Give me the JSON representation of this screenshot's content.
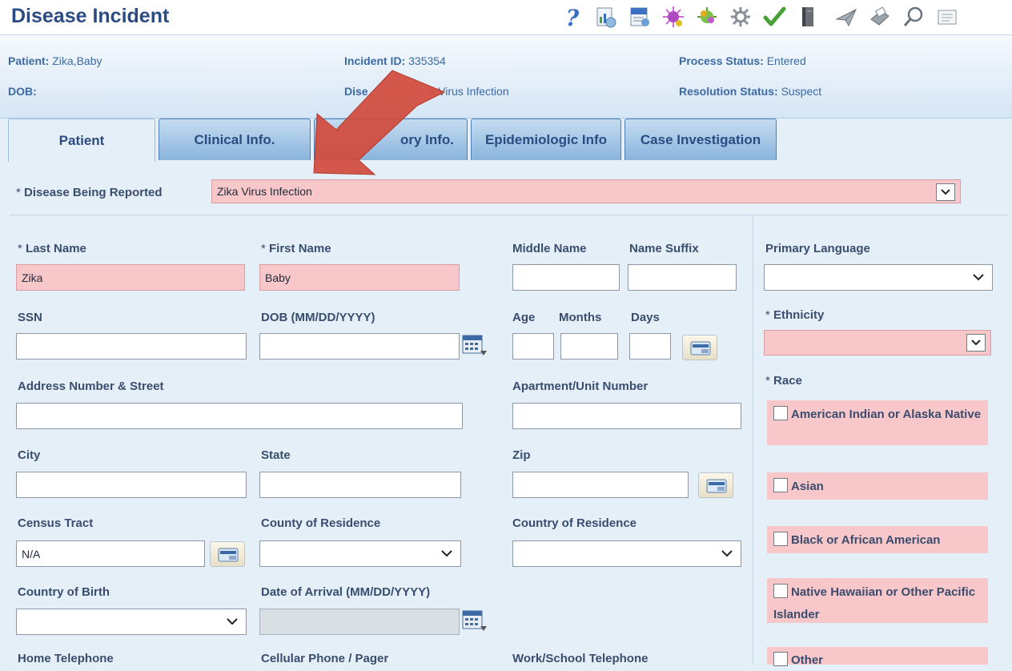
{
  "window": {
    "title": "Disease Incident"
  },
  "toolbar": {
    "icons": [
      "help-icon",
      "report-icon",
      "verify-icon",
      "virus-icon",
      "hand-icon",
      "gear-icon",
      "checkmark-icon",
      "book-icon",
      "send-icon",
      "print-icon",
      "search-icon",
      "notes-icon"
    ]
  },
  "header": {
    "patient_label": "Patient:",
    "patient_value": "Zika,Baby",
    "dob_label": "DOB:",
    "dob_value": "",
    "incident_label": "Incident ID:",
    "incident_value": "335354",
    "disease_label": "Dise",
    "disease_value": "a Virus Infection",
    "process_label": "Process Status:",
    "process_value": "Entered",
    "resolution_label": "Resolution Status:",
    "resolution_value": "Suspect"
  },
  "tabs": [
    {
      "label": "Patient"
    },
    {
      "label": "Clinical Info."
    },
    {
      "label": "ory Info."
    },
    {
      "label": "Epidemiologic Info"
    },
    {
      "label": "Case Investigation"
    }
  ],
  "disease": {
    "label": "Disease Being Reported",
    "value": "Zika Virus Infection"
  },
  "form": {
    "last_name": {
      "label": "Last Name",
      "value": "Zika"
    },
    "first_name": {
      "label": "First Name",
      "value": "Baby"
    },
    "middle_name": {
      "label": "Middle Name",
      "value": ""
    },
    "name_suffix": {
      "label": "Name Suffix",
      "value": ""
    },
    "ssn": {
      "label": "SSN",
      "value": ""
    },
    "dob": {
      "label": "DOB (MM/DD/YYYY)",
      "value": ""
    },
    "age": {
      "label": "Age",
      "value": ""
    },
    "months": {
      "label": "Months",
      "value": ""
    },
    "days": {
      "label": "Days",
      "value": ""
    },
    "address": {
      "label": "Address Number & Street",
      "value": ""
    },
    "apartment": {
      "label": "Apartment/Unit Number",
      "value": ""
    },
    "city": {
      "label": "City",
      "value": ""
    },
    "state": {
      "label": "State",
      "value": ""
    },
    "zip": {
      "label": "Zip",
      "value": ""
    },
    "census_tract": {
      "label": "Census Tract",
      "value": "N/A"
    },
    "county_residence": {
      "label": "County of Residence",
      "value": ""
    },
    "country_residence": {
      "label": "Country of Residence",
      "value": ""
    },
    "country_birth": {
      "label": "Country of Birth",
      "value": ""
    },
    "date_arrival": {
      "label": "Date of Arrival (MM/DD/YYYY)",
      "value": ""
    },
    "home_phone": {
      "label": "Home Telephone"
    },
    "cell_phone": {
      "label": "Cellular Phone / Pager"
    },
    "work_phone": {
      "label": "Work/School Telephone"
    }
  },
  "right_panel": {
    "primary_language": {
      "label": "Primary Language",
      "value": ""
    },
    "ethnicity": {
      "label": "Ethnicity",
      "value": ""
    },
    "race": {
      "label": "Race",
      "options": [
        {
          "label": "American Indian or Alaska Native"
        },
        {
          "label": "Asian"
        },
        {
          "label": "Black or African American"
        },
        {
          "label": "Native Hawaiian or Other Pacific Islander"
        },
        {
          "label": "Other"
        }
      ]
    }
  },
  "colors": {
    "required_field": "#f8c7c9",
    "title": "#2b4b82",
    "tab": "#8ab4dc",
    "annotation_arrow": "#d14a3c"
  }
}
